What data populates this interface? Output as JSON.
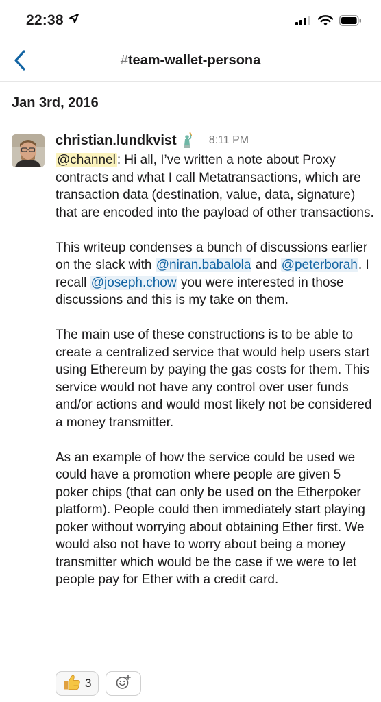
{
  "status_bar": {
    "time": "22:38",
    "icons": [
      "location-arrow-icon",
      "cellular-signal-icon",
      "wifi-icon",
      "battery-icon"
    ]
  },
  "nav": {
    "hash": "#",
    "channel_name": "team-wallet-persona",
    "icons": [
      "chevron-left-icon"
    ]
  },
  "date_header": "Jan 3rd, 2016",
  "message": {
    "author": "christian.lundkvist",
    "status_emoji": "statue-of-liberty-icon",
    "time": "8:11 PM",
    "p1": {
      "mention": "@channel",
      "text": ": Hi all, I’ve written a note about Proxy contracts and what I  call Metatransactions, which are transaction data (destination, value, data, signature) that are encoded into the payload of other transactions."
    },
    "p2": {
      "t1": "This writeup condenses a bunch of discussions earlier on the slack with ",
      "m1": "@niran.babalola",
      "t2": " and ",
      "m2": "@peterborah",
      "t3": ". I recall ",
      "m3": "@joseph.chow",
      "t4": " you were interested in those discussions and this is my take on them."
    },
    "p3": "The main use of these constructions is to be able to create a centralized service that would help users start using Ethereum by paying the gas costs for them. This service would not have any control over user funds and/or actions and would most likely not be considered a money transmitter.",
    "p4": "As an example of how the service could be used we could have a promotion where people are given 5 poker chips (that can only be used on the Etherpoker platform). People could then immediately start playing poker without worrying about obtaining Ether first. We would also not have to worry about being a money transmitter which would be the case if we were to let people pay for Ether with a credit card."
  },
  "reactions": [
    {
      "icon": "thumbs-up-icon",
      "count": "3"
    }
  ],
  "add_reaction_icon": "add-reaction-icon",
  "colors": {
    "accent_link": "#1264a3",
    "mention_bg": "#e8f1f8",
    "channel_mention_bg": "#fbf3bd",
    "back_arrow": "#1264a3",
    "muted_text": "#7a7a7a"
  }
}
